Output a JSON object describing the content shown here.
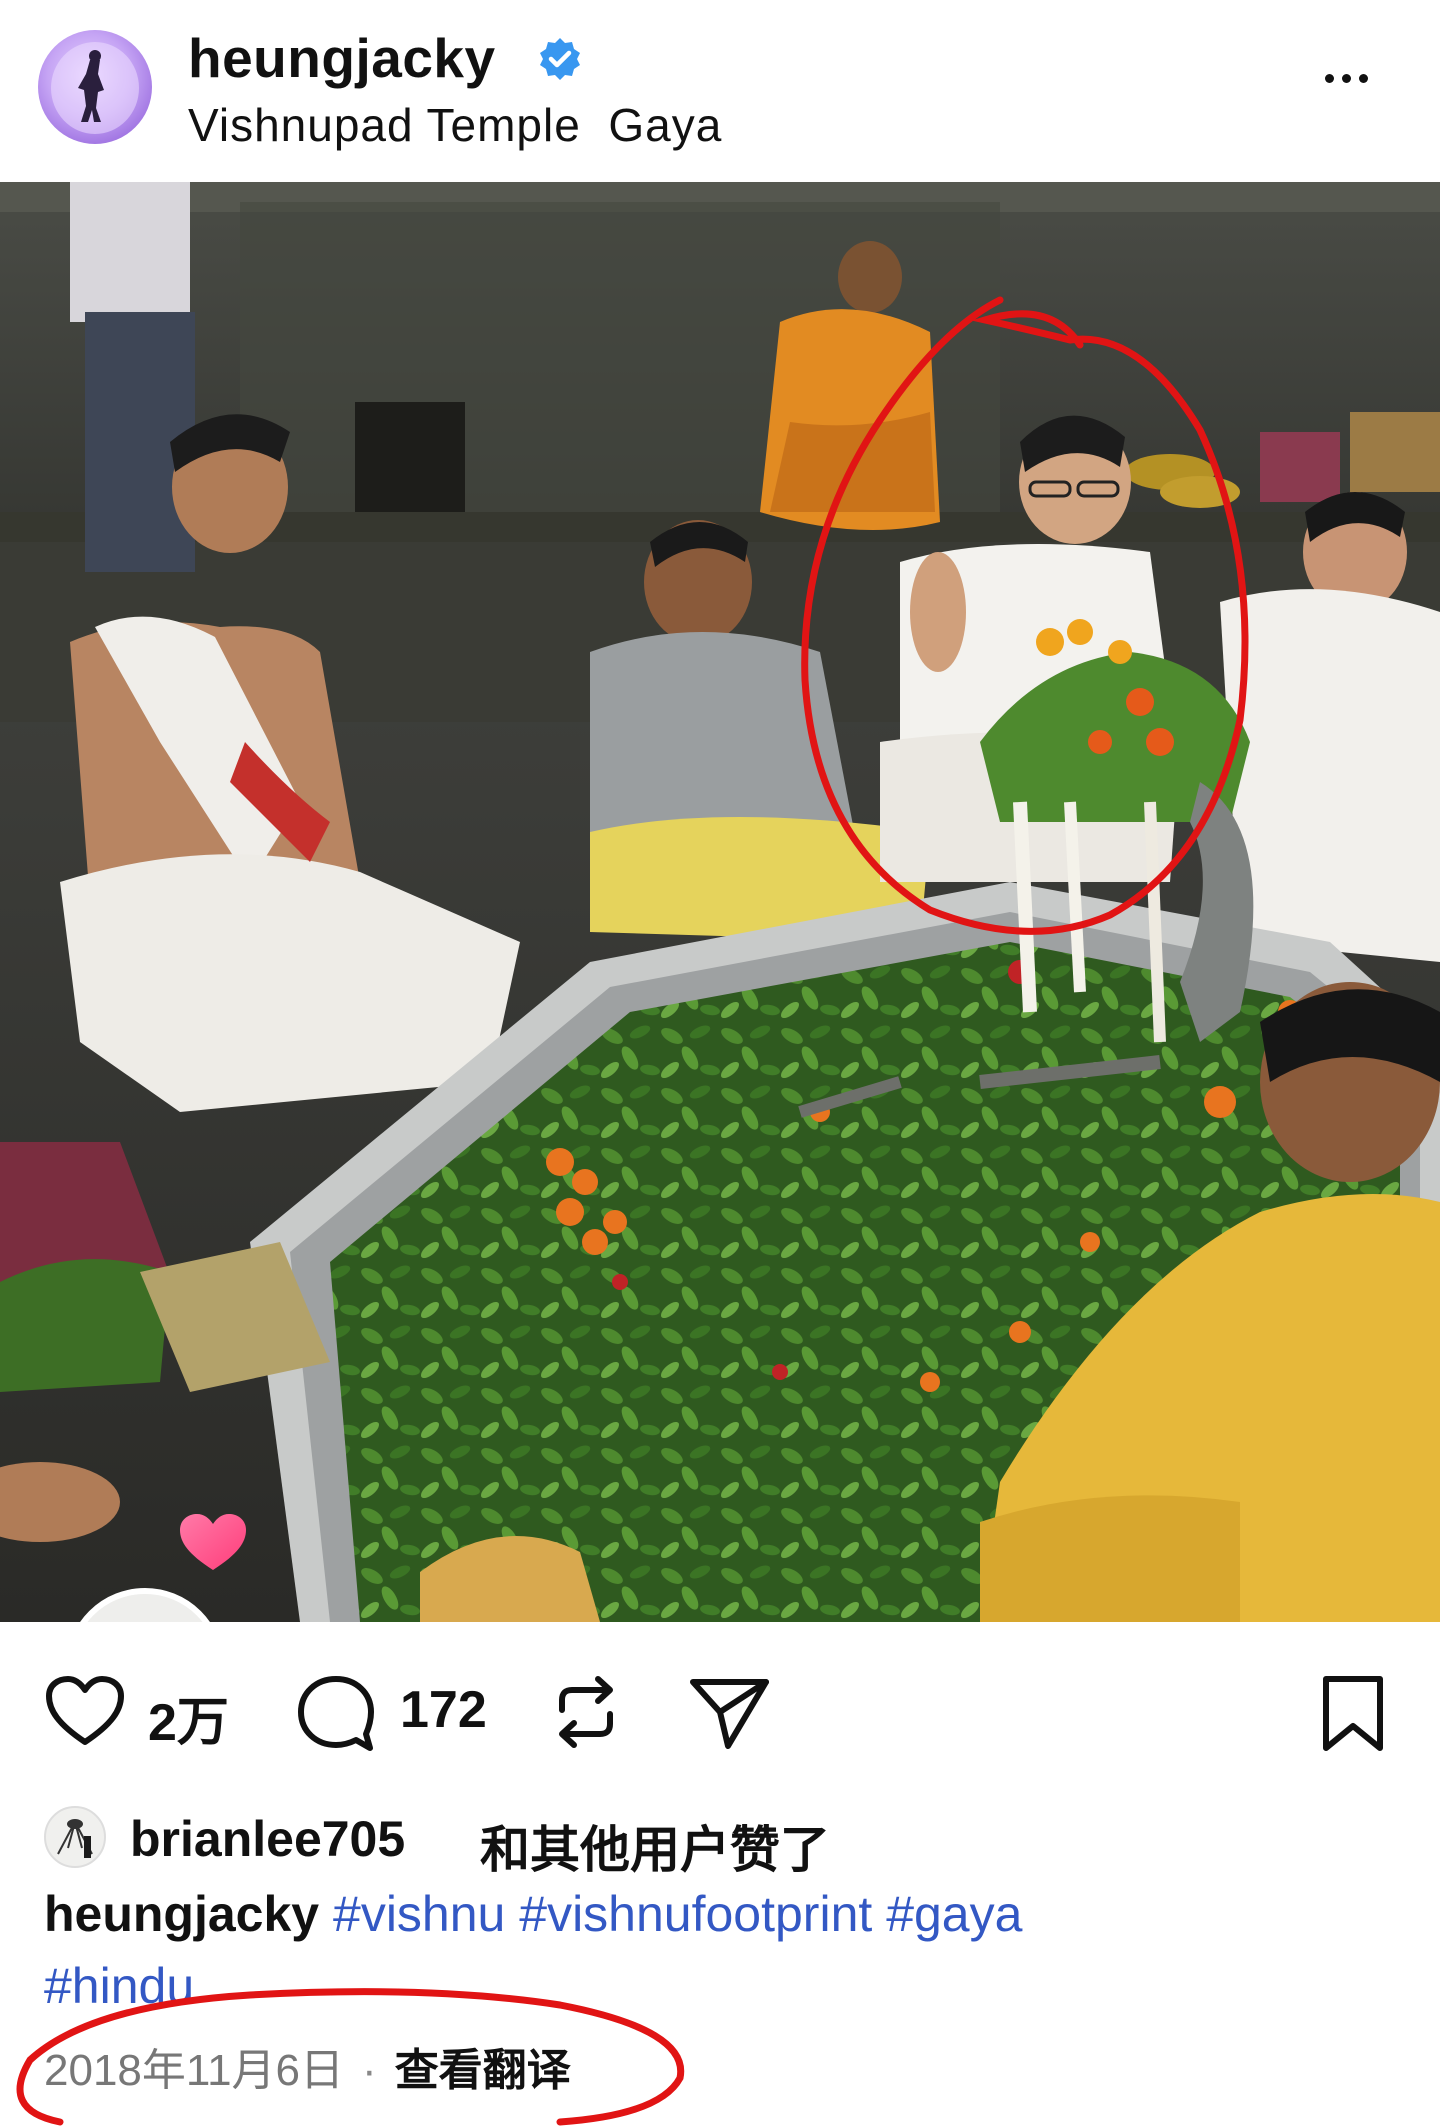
{
  "post": {
    "username": "heungjacky",
    "verified": true,
    "location": "Vishnupad Temple  Gaya",
    "photo_description_icon": "temple-ritual-photo",
    "actions": {
      "likes_count": "2万",
      "comments_count": "172"
    },
    "liked_by": {
      "user": "brianlee705",
      "suffix": "和其他用户赞了"
    },
    "caption": {
      "author": "heungjacky",
      "hashtags": [
        "#vishnu",
        "#vishnufootprint",
        "#gaya",
        "#hindu"
      ]
    },
    "date": "2018年11月6日",
    "separator": "·",
    "translate_label": "查看翻译"
  },
  "icons": {
    "verified": "verified-badge-icon",
    "more": "more-options-icon",
    "like": "heart-icon",
    "comment": "comment-bubble-icon",
    "repost": "repost-icon",
    "share": "send-icon",
    "save": "bookmark-icon"
  },
  "colors": {
    "verified_blue": "#3897f0",
    "hashtag_blue": "#3358c4",
    "annotation_red": "#e11414",
    "muted_text": "#777777"
  }
}
